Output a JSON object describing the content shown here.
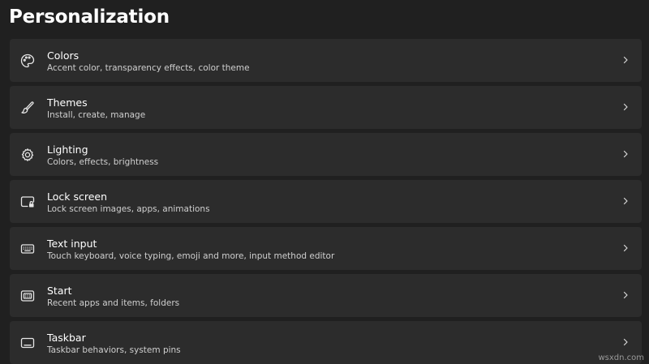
{
  "page": {
    "title": "Personalization"
  },
  "items": [
    {
      "title": "Colors",
      "subtitle": "Accent color, transparency effects, color theme",
      "icon": "palette-icon"
    },
    {
      "title": "Themes",
      "subtitle": "Install, create, manage",
      "icon": "brush-icon"
    },
    {
      "title": "Lighting",
      "subtitle": "Colors, effects, brightness",
      "icon": "gear-icon"
    },
    {
      "title": "Lock screen",
      "subtitle": "Lock screen images, apps, animations",
      "icon": "lock-screen-icon"
    },
    {
      "title": "Text input",
      "subtitle": "Touch keyboard, voice typing, emoji and more, input method editor",
      "icon": "keyboard-icon"
    },
    {
      "title": "Start",
      "subtitle": "Recent apps and items, folders",
      "icon": "start-icon"
    },
    {
      "title": "Taskbar",
      "subtitle": "Taskbar behaviors, system pins",
      "icon": "taskbar-icon"
    }
  ],
  "watermark": "wsxdn.com",
  "colors": {
    "background": "#202020",
    "card": "#2c2c2c",
    "text": "#ffffff",
    "subtext": "#cfcfcf"
  }
}
